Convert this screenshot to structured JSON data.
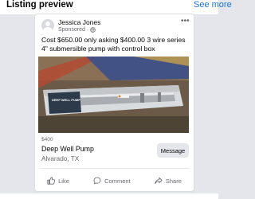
{
  "header": {
    "title": "Listing preview",
    "see_more": "See more"
  },
  "post": {
    "author": "Jessica Jones",
    "sponsored": "Sponsored ·",
    "text": "Cost $650.00 only asking $400.00 3 wire series 4\" submersible pump with control box"
  },
  "listing": {
    "price": "$400",
    "title": "Deep Well Pump",
    "location": "Alvarado, TX",
    "message_label": "Message",
    "photo_caption": "DEEP WELL PUMP"
  },
  "actions": {
    "like": "Like",
    "comment": "Comment",
    "share": "Share"
  },
  "colors": {
    "link": "#1b74e4",
    "secondary_text": "#65676b",
    "button_bg": "#e4e6eb"
  }
}
